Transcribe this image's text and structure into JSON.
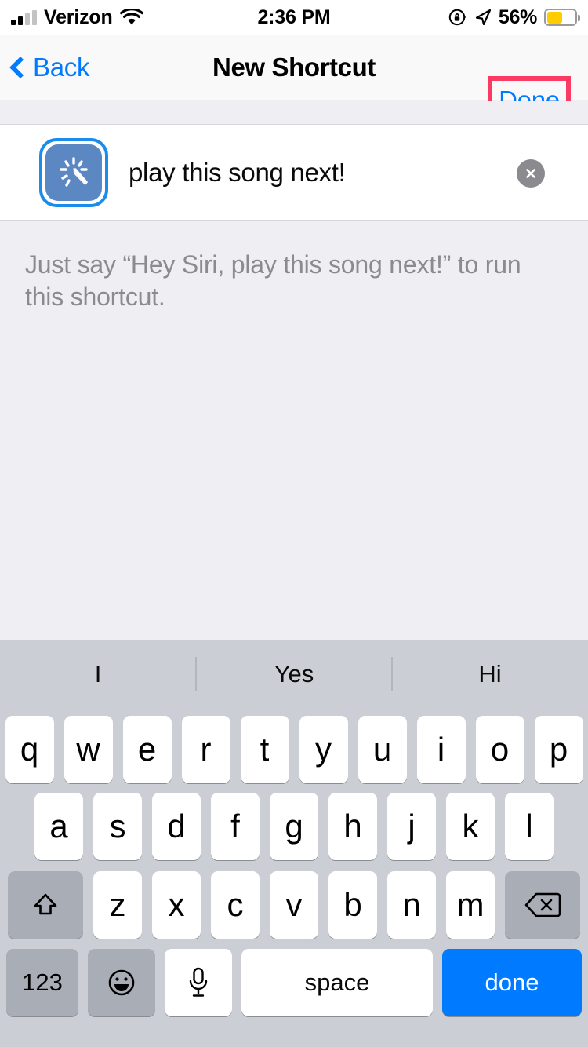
{
  "statusbar": {
    "carrier": "Verizon",
    "wifi_icon": "wifi-icon",
    "signal_icon": "cellular-signal-icon",
    "time": "2:36 PM",
    "rotation_lock_icon": "rotation-lock-icon",
    "location_icon": "location-arrow-icon",
    "battery_percent": "56%",
    "battery_icon": "battery-low-power-icon",
    "battery_fill_color": "#FFCC00"
  },
  "navbar": {
    "back_label": "Back",
    "back_icon": "chevron-left-icon",
    "title": "New Shortcut",
    "done_label": "Done",
    "highlight_color": "#FB3B64",
    "tint_color": "#007AFF"
  },
  "phrase_row": {
    "shortcut_icon": "magic-wand-icon",
    "icon_bg_color": "#5B87C2",
    "icon_ring_color": "#1C8CEA",
    "text": "play this song next!",
    "clear_icon": "clear-circle-x-icon"
  },
  "hint": {
    "text": "Just say “Hey Siri, play this song next!” to run this shortcut."
  },
  "keyboard": {
    "predictions": [
      "I",
      "Yes",
      "Hi"
    ],
    "row1": [
      "q",
      "w",
      "e",
      "r",
      "t",
      "y",
      "u",
      "i",
      "o",
      "p"
    ],
    "row2": [
      "a",
      "s",
      "d",
      "f",
      "g",
      "h",
      "j",
      "k",
      "l"
    ],
    "row3": [
      "z",
      "x",
      "c",
      "v",
      "b",
      "n",
      "m"
    ],
    "shift_icon": "shift-arrow-up-icon",
    "backspace_icon": "backspace-delete-icon",
    "numeric_label": "123",
    "emoji_icon": "emoji-smiley-icon",
    "dictation_icon": "microphone-icon",
    "space_label": "space",
    "return_label": "done",
    "return_color": "#007AFF"
  }
}
